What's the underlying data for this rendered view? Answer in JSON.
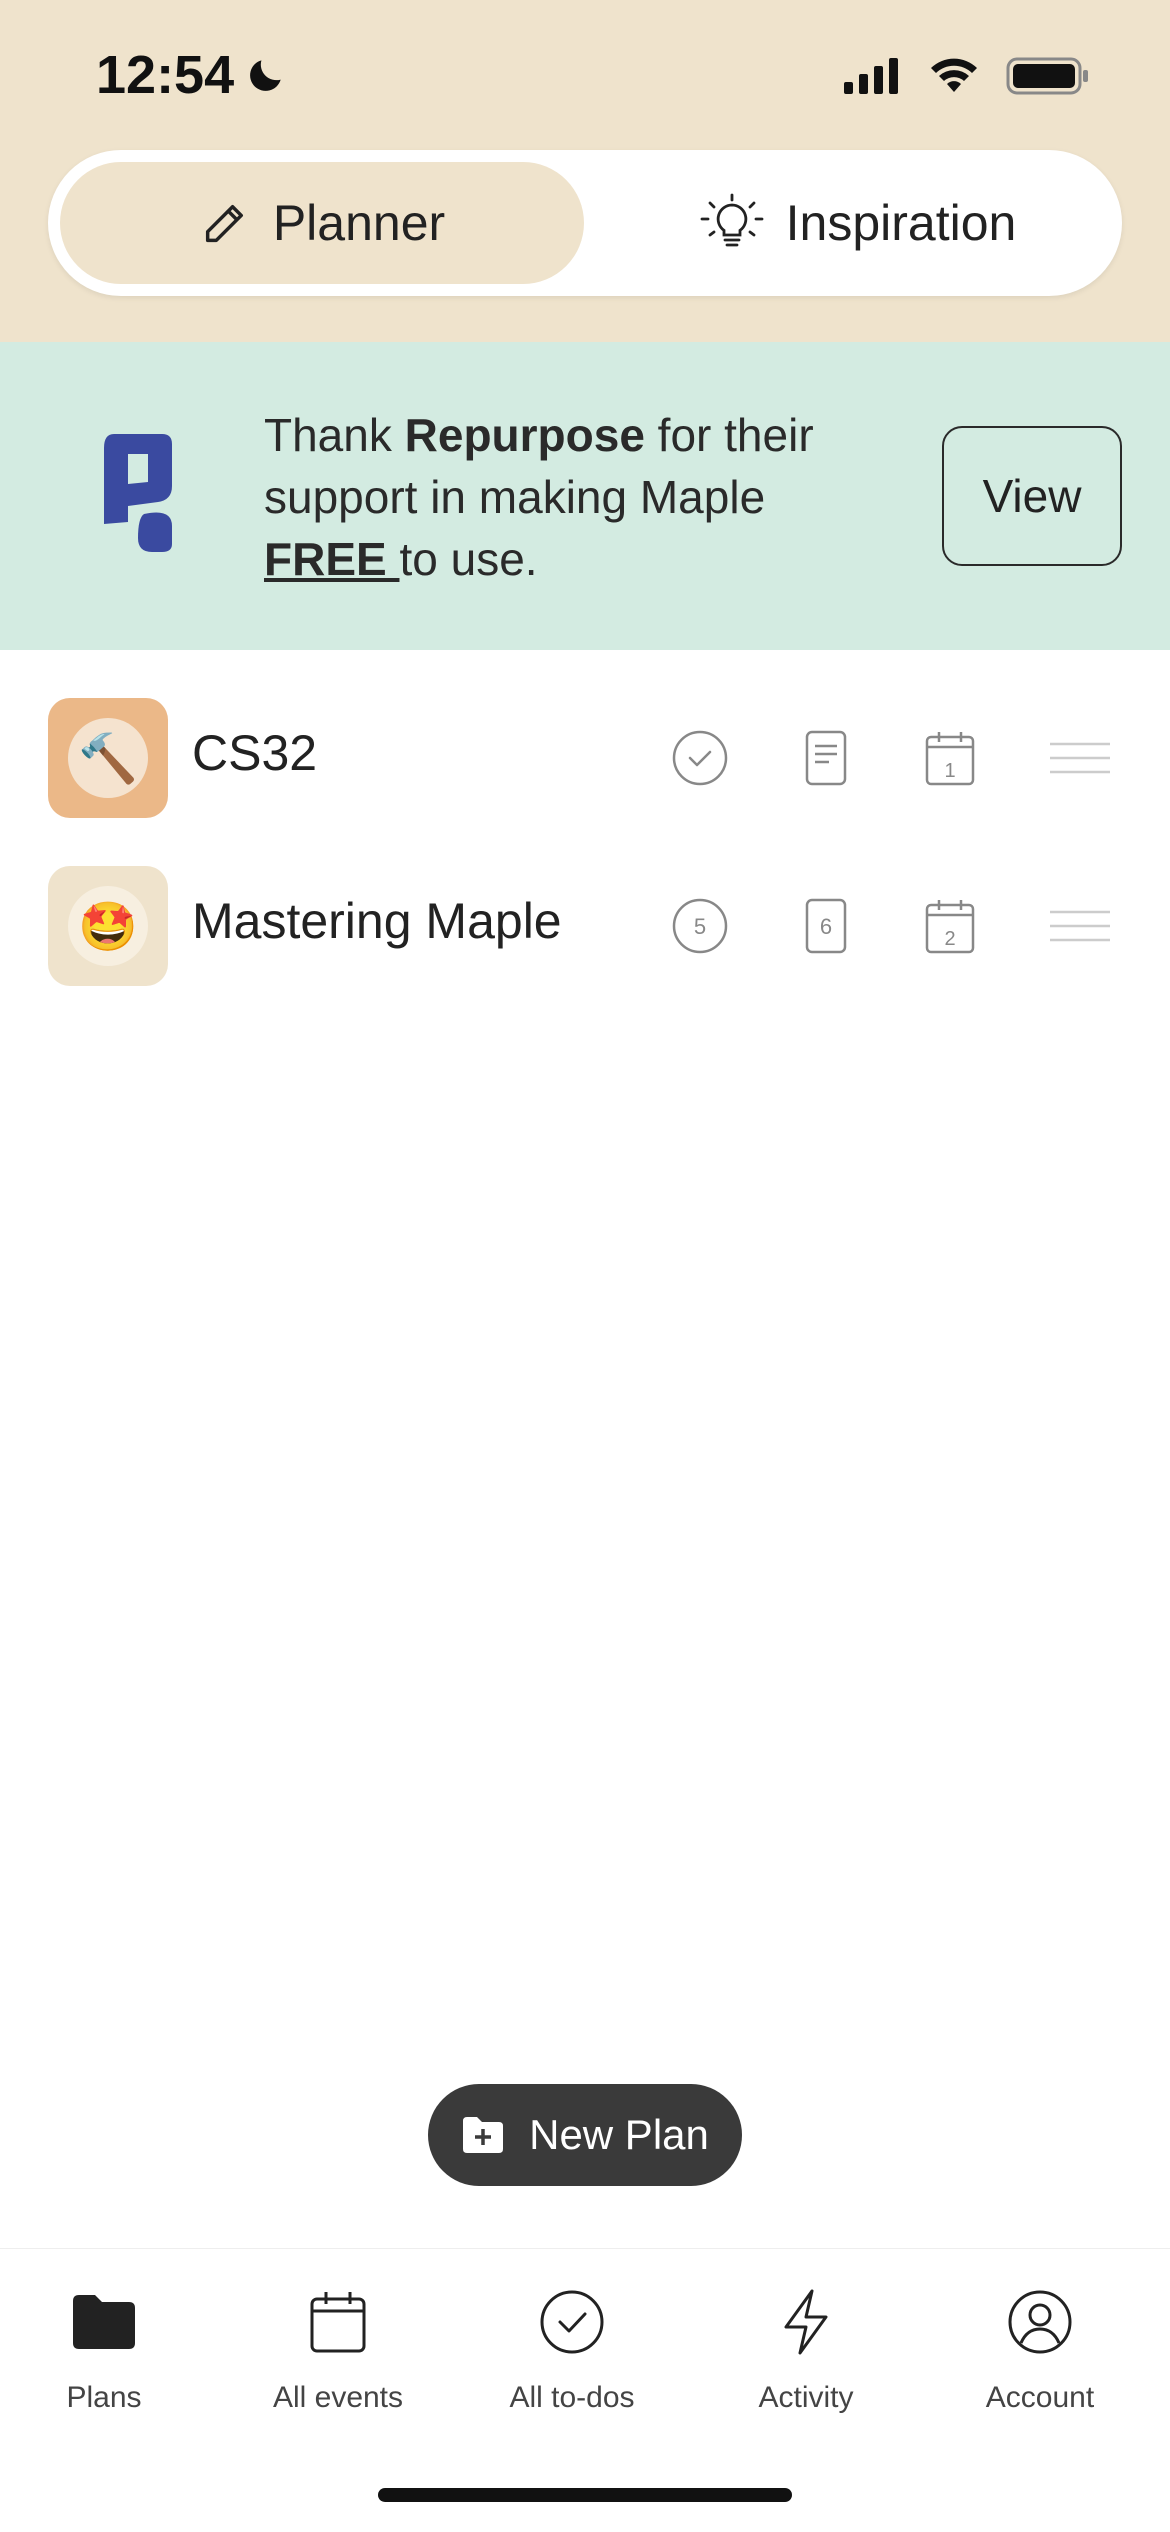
{
  "status_bar": {
    "time": "12:54"
  },
  "segmented": {
    "planner": "Planner",
    "inspiration": "Inspiration"
  },
  "banner": {
    "text_before": "Thank ",
    "sponsor": "Repurpose",
    "text_middle": " for their support in making Maple ",
    "free": "FREE ",
    "text_after": "to use.",
    "view_label": "View"
  },
  "plans": [
    {
      "name": "CS32",
      "emoji": "🔨",
      "count_todos": "",
      "count_docs": "",
      "count_events": "1"
    },
    {
      "name": "Mastering Maple",
      "emoji": "🤩",
      "count_todos": "5",
      "count_docs": "6",
      "count_events": "2"
    }
  ],
  "new_plan_label": "New Plan",
  "nav": {
    "plans": "Plans",
    "events": "All events",
    "todos": "All to-dos",
    "activity": "Activity",
    "account": "Account"
  },
  "colors": {
    "header_bg": "#efe3cc",
    "banner_bg": "#d3ebe1",
    "logo_blue": "#3a4aa0"
  }
}
